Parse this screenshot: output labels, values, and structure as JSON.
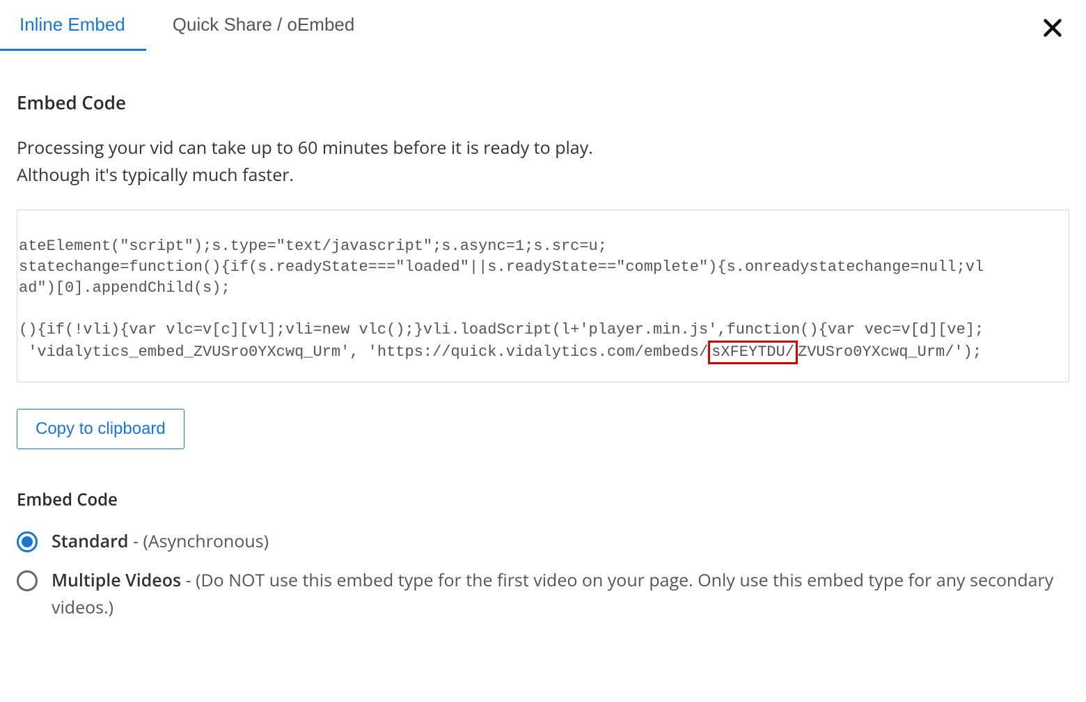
{
  "tabs": {
    "inline": "Inline Embed",
    "quickshare": "Quick Share / oEmbed"
  },
  "heading1": "Embed Code",
  "processing_line1": "Processing your vid can take up to 60 minutes before it is ready to play.",
  "processing_line2": "Although it's typically much faster.",
  "code": {
    "l1": "ateElement(\"script\");s.type=\"text/javascript\";s.async=1;s.src=u;",
    "l2": "statechange=function(){if(s.readyState===\"loaded\"||s.readyState==\"complete\"){s.onreadystatechange=null;vl",
    "l3": "ad\")[0].appendChild(s);",
    "l4": "",
    "l5": "(){if(!vli){var vlc=v[c][vl];vli=new vlc();}vli.loadScript(l+'player.min.js',function(){var vec=v[d][ve];",
    "l6_pre": " 'vidalytics_embed_ZVUSro0YXcwq_Urm', 'https://quick.vidalytics.com/embeds/",
    "l6_highlight": "sXFEYTDU/",
    "l6_post": "ZVUSro0YXcwq_Urm/');"
  },
  "copy_btn": "Copy to clipboard",
  "heading2": "Embed Code",
  "radios": {
    "standard": {
      "label": "Standard",
      "hint": " - (Asynchronous)"
    },
    "multiple": {
      "label": "Multiple Videos",
      "hint": " - (Do NOT use this embed type for the first video on your page. Only use this embed type for any secondary videos.)"
    }
  }
}
